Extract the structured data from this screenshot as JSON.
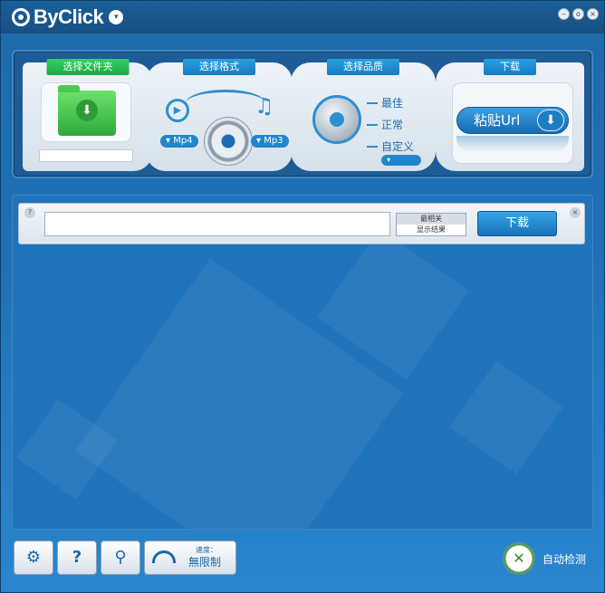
{
  "app": {
    "logo_text": "ByClick",
    "dropdown_glyph": "▾",
    "window_buttons": [
      "‒",
      "o",
      "×"
    ]
  },
  "steps": {
    "folder": {
      "tab_label": "选择文件夹",
      "icon": "folder-download-icon",
      "path_value": ""
    },
    "format": {
      "tab_label": "选择格式",
      "video_format": "Mp4",
      "audio_format": "Mp3"
    },
    "quality": {
      "tab_label": "选择品质",
      "options": [
        "最佳",
        "正常",
        "自定义"
      ],
      "dropdown_glyph": "▾"
    },
    "download": {
      "tab_label": "下载",
      "paste_label": "粘贴Url",
      "paste_arrow": "⬇"
    }
  },
  "search": {
    "help_glyph": "?",
    "close_glyph": "×",
    "url_value": "",
    "url_placeholder": "",
    "sort_top": "最相关",
    "sort_bottom": "显示结果",
    "download_label": "下载"
  },
  "bottom": {
    "settings_icon": "gear-icon",
    "help_label": "?",
    "search_label": "⚲",
    "speed_caption": "速度：",
    "speed_value": "無限制",
    "auto_detect_label": "自动检测"
  },
  "colors": {
    "window_bg": "#1e6fb4",
    "titlebar": "#1b5f99",
    "accent_blue": "#1f86cc",
    "folder_green": "#2ea83c",
    "tab_green": "#1ba745"
  }
}
